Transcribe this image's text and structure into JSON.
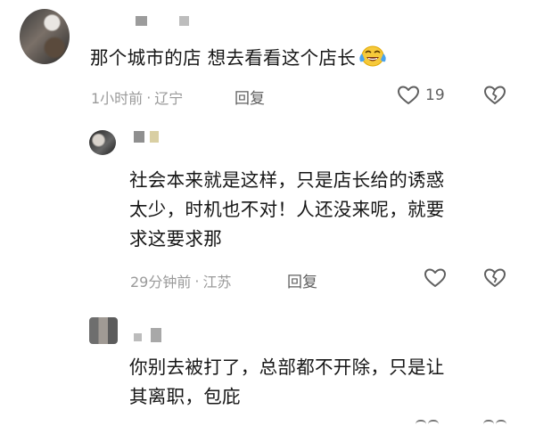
{
  "comments": [
    {
      "text": "那个城市的店 想去看看这个店长",
      "emoji": "😂",
      "time": "1小时前",
      "location": "辽宁",
      "reply_label": "回复",
      "likes": "19"
    },
    {
      "text_lines": [
        "社会本来就是这样，只是店长给的诱惑",
        "太少，时机也不对！人还没来呢，就要",
        "求这要求那"
      ],
      "time": "29分钟前",
      "location": "江苏",
      "reply_label": "回复"
    },
    {
      "text_lines": [
        "你别去被打了，总部都不开除，只是让",
        "其离职，包庇"
      ]
    }
  ],
  "meta_separator": "·",
  "icons": {
    "like": "heart-outline-icon",
    "dislike": "broken-heart-icon",
    "emoji": "laughing-tears-emoji"
  },
  "colors": {
    "text": "#161616",
    "meta": "#9a9a9a",
    "icon": "#5f5f5f"
  }
}
